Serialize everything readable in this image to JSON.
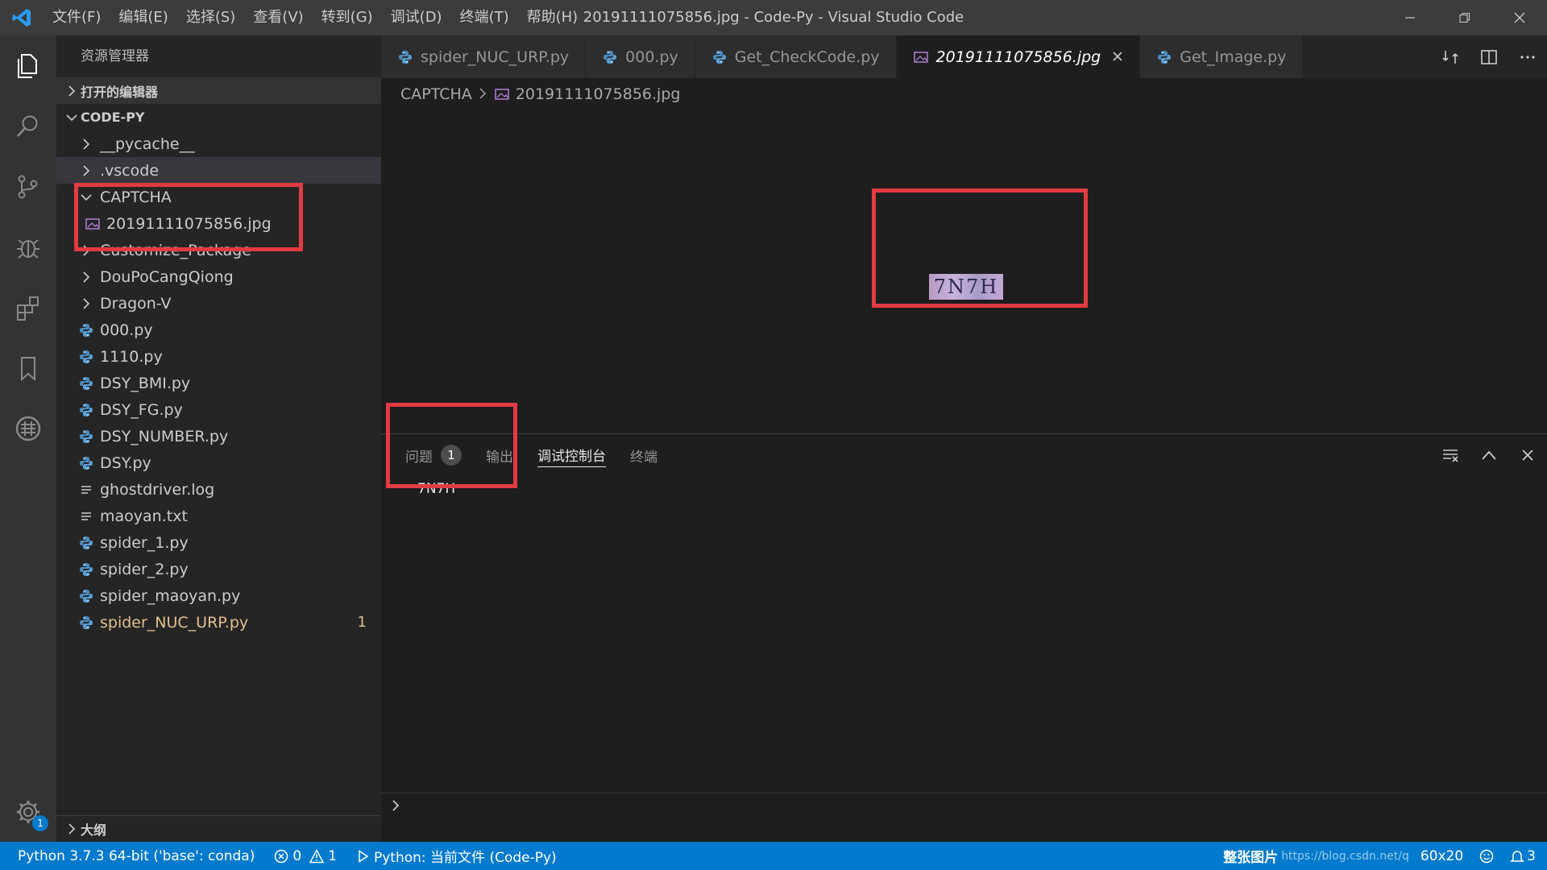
{
  "window": {
    "title": "20191111075856.jpg - Code-Py - Visual Studio Code",
    "menu": [
      "文件(F)",
      "编辑(E)",
      "选择(S)",
      "查看(V)",
      "转到(G)",
      "调试(D)",
      "终端(T)",
      "帮助(H)"
    ]
  },
  "activitybar": {
    "items": [
      "explorer-icon",
      "search-icon",
      "source-control-icon",
      "debug-icon",
      "extensions-icon",
      "bookmark-icon",
      "remote-icon"
    ],
    "settings_badge": "1"
  },
  "sidebar": {
    "title": "资源管理器",
    "open_editors": "打开的编辑器",
    "workspace": "CODE-PY",
    "outline": "大纲",
    "tree": [
      {
        "label": "__pycache__",
        "kind": "folder",
        "depth": 1,
        "expanded": false
      },
      {
        "label": ".vscode",
        "kind": "folder",
        "depth": 1,
        "expanded": false,
        "selected": true
      },
      {
        "label": "CAPTCHA",
        "kind": "folder",
        "depth": 1,
        "expanded": true
      },
      {
        "label": "20191111075856.jpg",
        "kind": "image",
        "depth": 2
      },
      {
        "label": "Customize_Package",
        "kind": "folder",
        "depth": 1,
        "expanded": false
      },
      {
        "label": "DouPoCangQiong",
        "kind": "folder",
        "depth": 1,
        "expanded": false
      },
      {
        "label": "Dragon-V",
        "kind": "folder",
        "depth": 1,
        "expanded": false
      },
      {
        "label": "000.py",
        "kind": "python",
        "depth": 1
      },
      {
        "label": "1110.py",
        "kind": "python",
        "depth": 1
      },
      {
        "label": "DSY_BMI.py",
        "kind": "python",
        "depth": 1
      },
      {
        "label": "DSY_FG.py",
        "kind": "python",
        "depth": 1
      },
      {
        "label": "DSY_NUMBER.py",
        "kind": "python",
        "depth": 1
      },
      {
        "label": "DSY.py",
        "kind": "python",
        "depth": 1
      },
      {
        "label": "ghostdriver.log",
        "kind": "text",
        "depth": 1
      },
      {
        "label": "maoyan.txt",
        "kind": "text",
        "depth": 1
      },
      {
        "label": "spider_1.py",
        "kind": "python",
        "depth": 1
      },
      {
        "label": "spider_2.py",
        "kind": "python",
        "depth": 1
      },
      {
        "label": "spider_maoyan.py",
        "kind": "python",
        "depth": 1
      },
      {
        "label": "spider_NUC_URP.py",
        "kind": "python",
        "depth": 1,
        "modified": true,
        "count": "1"
      }
    ]
  },
  "tabs": [
    {
      "label": "spider_NUC_URP.py",
      "kind": "python"
    },
    {
      "label": "000.py",
      "kind": "python"
    },
    {
      "label": "Get_CheckCode.py",
      "kind": "python"
    },
    {
      "label": "20191111075856.jpg",
      "kind": "image",
      "active": true
    },
    {
      "label": "Get_Image.py",
      "kind": "python"
    }
  ],
  "breadcrumb": {
    "folder": "CAPTCHA",
    "file": "20191111075856.jpg"
  },
  "image_preview": {
    "captcha_text": "7N7H"
  },
  "panel": {
    "tabs": [
      {
        "label": "问题",
        "badge": "1"
      },
      {
        "label": "输出"
      },
      {
        "label": "调试控制台",
        "active": true
      },
      {
        "label": "终端"
      }
    ],
    "output_line": "7N7H"
  },
  "statusbar": {
    "interpreter": "Python 3.7.3 64-bit ('base': conda)",
    "errors": "0",
    "warnings": "1",
    "run_config": "Python: 当前文件 (Code-Py)",
    "right_label": "整张图片",
    "watermark": "https://blog.csdn.net/q",
    "dimensions": "60x20",
    "notifications": "3"
  },
  "colors": {
    "accent": "#007acc",
    "highlight_box": "#e23b41",
    "modified": "#e2c08d"
  }
}
